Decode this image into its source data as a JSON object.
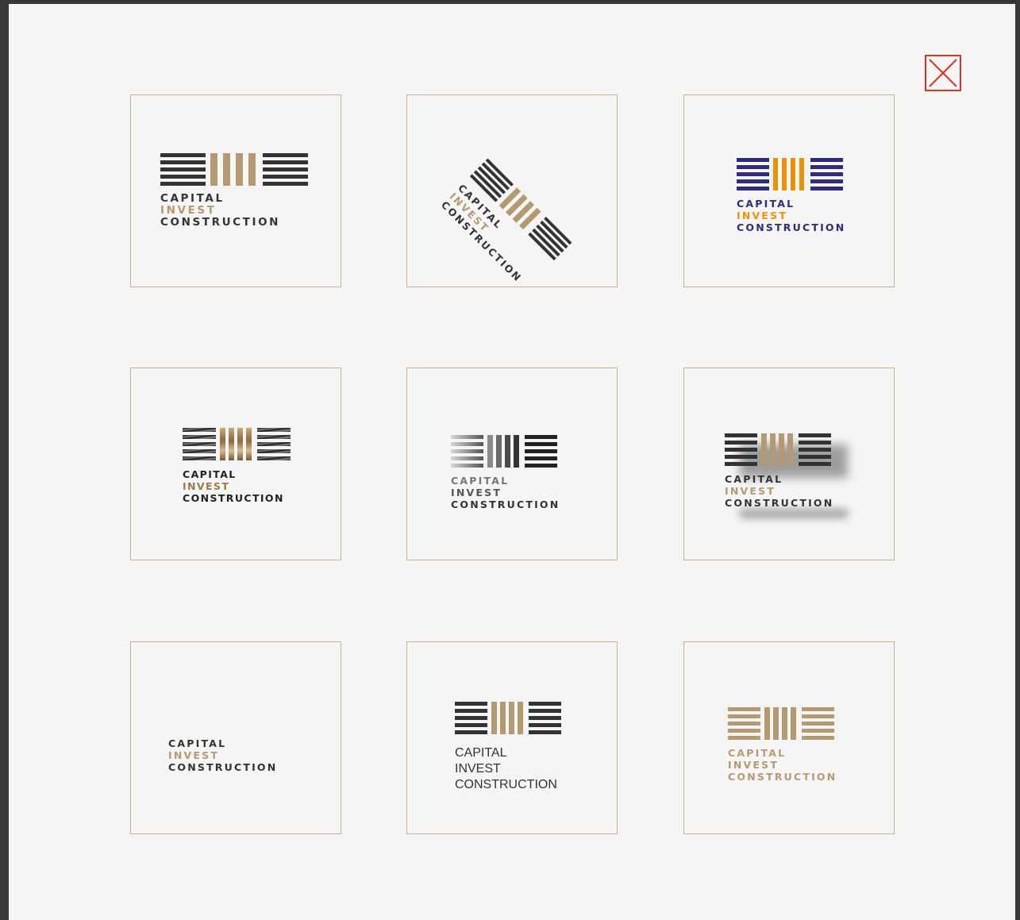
{
  "overlay": {
    "close_icon": "close-icon",
    "close_color": "#d9352a"
  },
  "logo": {
    "line1": "CAPITAL",
    "line2": "INVEST",
    "line3": "CONSTRUCTION"
  },
  "cards": [
    {
      "variant": "classic-gold-dark"
    },
    {
      "variant": "diagonal-rotated"
    },
    {
      "variant": "navy-orange"
    },
    {
      "variant": "marble-texture"
    },
    {
      "variant": "grayscale-gradient"
    },
    {
      "variant": "drop-shadow"
    },
    {
      "variant": "text-only"
    },
    {
      "variant": "plain-type"
    },
    {
      "variant": "all-gold"
    }
  ],
  "colors": {
    "dark": "#333333",
    "gold": "#b49a73",
    "navy": "#2e2a7c",
    "orange": "#e8930a",
    "border": "#c9b293"
  }
}
